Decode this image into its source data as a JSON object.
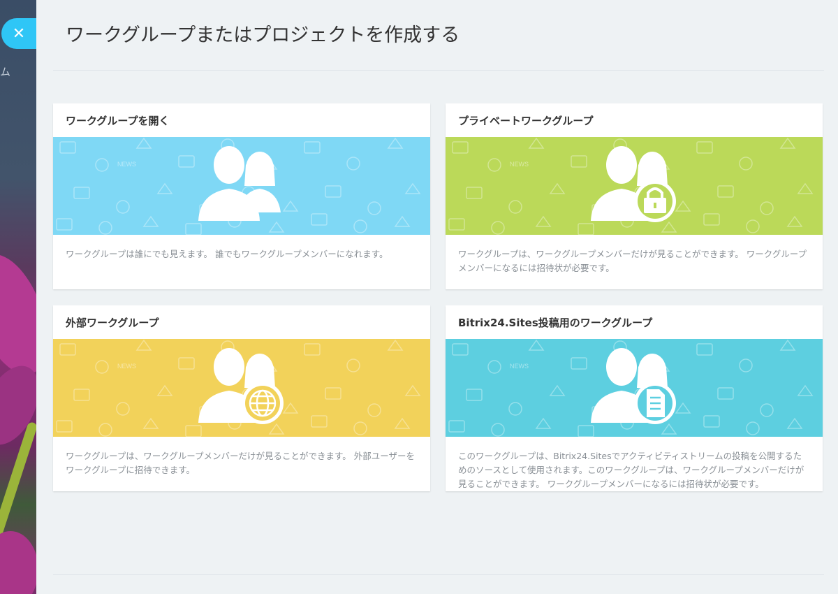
{
  "page": {
    "title": "ワークグループまたはプロジェクトを作成する",
    "close_symbol": "✕",
    "side_text": "ム"
  },
  "cards": [
    {
      "title": "ワークグループを開く",
      "description": "ワークグループは誰にでも見えます。 誰でもワークグループメンバーになれます。",
      "color": "#7fd8f5",
      "badge_icon": "none",
      "news_label": "NEWS"
    },
    {
      "title": "プライベートワークグループ",
      "description": "ワークグループは、ワークグループメンバーだけが見ることができます。 ワークグループメンバーになるには招待状が必要です。",
      "color": "#bbd959",
      "badge_icon": "lock-icon",
      "news_label": "NEWS"
    },
    {
      "title": "外部ワークグループ",
      "description": "ワークグループは、ワークグループメンバーだけが見ることができます。 外部ユーザーをワークグループに招待できます。",
      "color": "#f2d25a",
      "badge_icon": "globe-icon",
      "news_label": "NEWS"
    },
    {
      "title": "Bitrix24.Sites投稿用のワークグループ",
      "description": "このワークグループは、Bitrix24.Sitesでアクティビティストリームの投稿を公開するためのソースとして使用されます。このワークグループは、ワークグループメンバーだけが見ることができます。 ワークグループメンバーになるには招待状が必要です。",
      "color": "#5dcfe0",
      "badge_icon": "document-icon",
      "news_label": "NEWS"
    }
  ]
}
